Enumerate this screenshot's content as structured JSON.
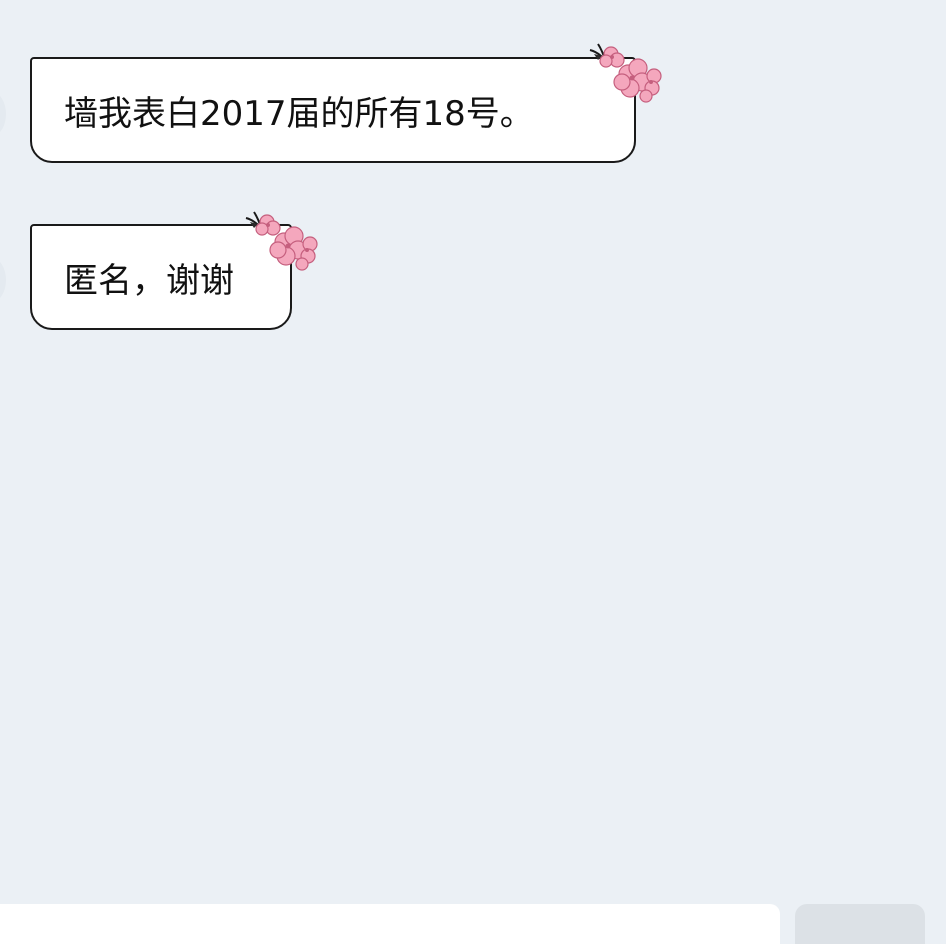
{
  "conversation": {
    "messages": [
      {
        "text": "墙我表白2017届的所有18号。",
        "decoration": "pink-blossom"
      },
      {
        "text": "匿名，谢谢",
        "decoration": "pink-blossom"
      }
    ]
  },
  "colors": {
    "background": "#ebf0f5",
    "bubble": "#ffffff",
    "bubble_border": "#1a1a1a",
    "blossom": "#f4a7bd",
    "input": "#ffffff",
    "send": "#dce1e6"
  },
  "input": {
    "placeholder": ""
  },
  "icons": [
    "pink-blossom-icon"
  ]
}
